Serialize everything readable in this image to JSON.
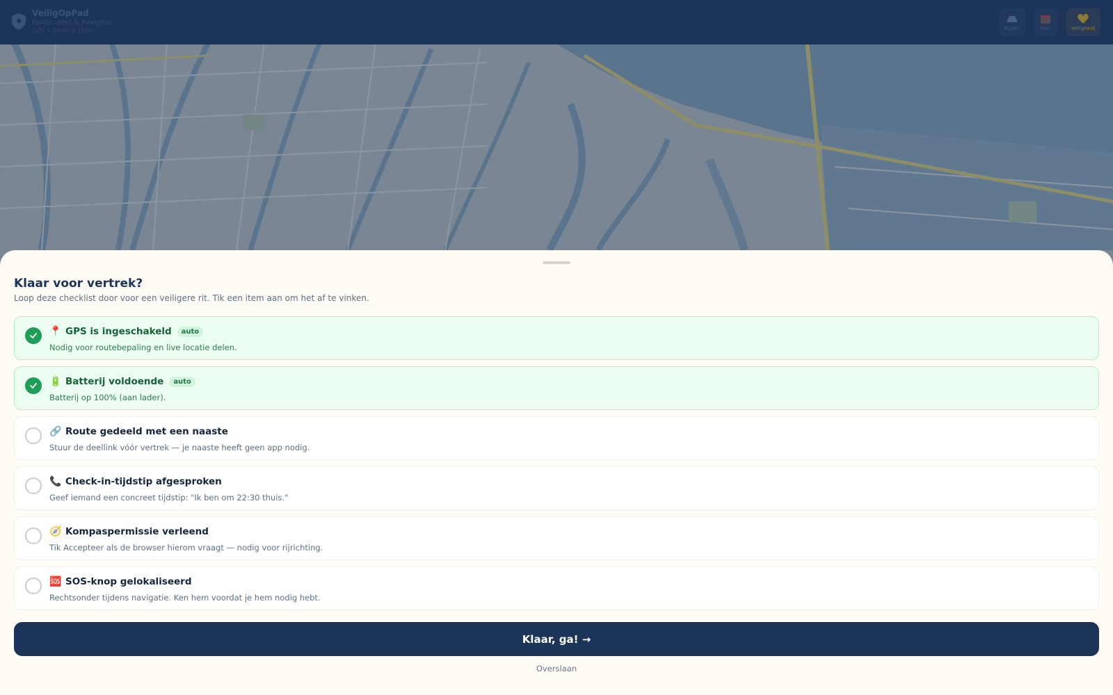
{
  "header": {
    "app_name": "VeiligOpPad",
    "tagline": "Route, deel & navigeer",
    "status": "GPS • Batterij 100%",
    "actions": [
      {
        "label": "Rijden",
        "icon": "car-icon"
      },
      {
        "label": "Plan",
        "icon": "calendar-icon"
      },
      {
        "label": "Veiligheid",
        "icon": "heart-icon"
      }
    ],
    "colors": {
      "bar": "#1d3459"
    }
  },
  "sheet": {
    "title": "Klaar voor vertrek?",
    "subtitle": "Loop deze checklist door voor een veiligere rit. Tik een item aan om het af te vinken.",
    "items": [
      {
        "emoji": "📍",
        "title": "GPS is ingeschakeld",
        "badge": "auto",
        "desc": "Nodig voor routebepaling en live locatie delen.",
        "checked": true
      },
      {
        "emoji": "🔋",
        "title": "Batterij voldoende",
        "badge": "auto",
        "desc": "Batterij op 100% (aan lader).",
        "checked": true
      },
      {
        "emoji": "🔗",
        "title": "Route gedeeld met een naaste",
        "badge": "",
        "desc": "Stuur de deellink vóór vertrek — je naaste heeft geen app nodig.",
        "checked": false
      },
      {
        "emoji": "📞",
        "title": "Check-in-tijdstip afgesproken",
        "badge": "",
        "desc": "Geef iemand een concreet tijdstip: \"Ik ben om 22:30 thuis.\"",
        "checked": false
      },
      {
        "emoji": "🧭",
        "title": "Kompaspermissie verleend",
        "badge": "",
        "desc": "Tik Accepteer als de browser hierom vraagt — nodig voor rijrichting.",
        "checked": false
      },
      {
        "emoji": "🆘",
        "title": "SOS-knop gelokaliseerd",
        "badge": "",
        "desc": "Rechtsonder tijdens navigatie. Ken hem voordat je hem nodig hebt.",
        "checked": false
      }
    ],
    "primary_label": "Klaar, ga! →",
    "skip_label": "Overslaan",
    "colors": {
      "primary": "#1d3459",
      "success": "#1f9e57",
      "success_bg": "#ecfdf1"
    }
  }
}
